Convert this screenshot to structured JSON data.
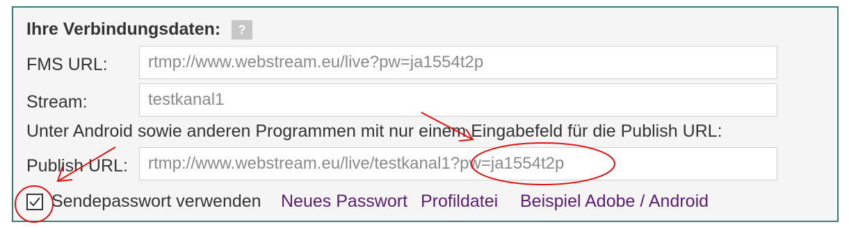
{
  "section": {
    "title": "Ihre Verbindungsdaten:",
    "help_label": "?"
  },
  "fields": {
    "fms_url": {
      "label": "FMS URL:",
      "value": "rtmp://www.webstream.eu/live?pw=ja1554t2p"
    },
    "stream": {
      "label": "Stream:",
      "value": "testkanal1"
    },
    "publish_url": {
      "label": "Publish URL:",
      "value": "rtmp://www.webstream.eu/live/testkanal1?pw=ja1554t2p"
    }
  },
  "info_text": "Unter Android sowie anderen Programmen mit nur einem Eingabefeld für die Publish URL:",
  "send_password": {
    "label": "Sendepasswort verwenden",
    "checked": true
  },
  "links": {
    "new_password": "Neues Passwort",
    "profile_file": "Profildatei",
    "example": "Beispiel Adobe / Android"
  },
  "colors": {
    "panel_border": "#2f7f76",
    "panel_bg": "#f5f5f5",
    "link": "#5b1d6f",
    "annotation": "#dd1111"
  }
}
